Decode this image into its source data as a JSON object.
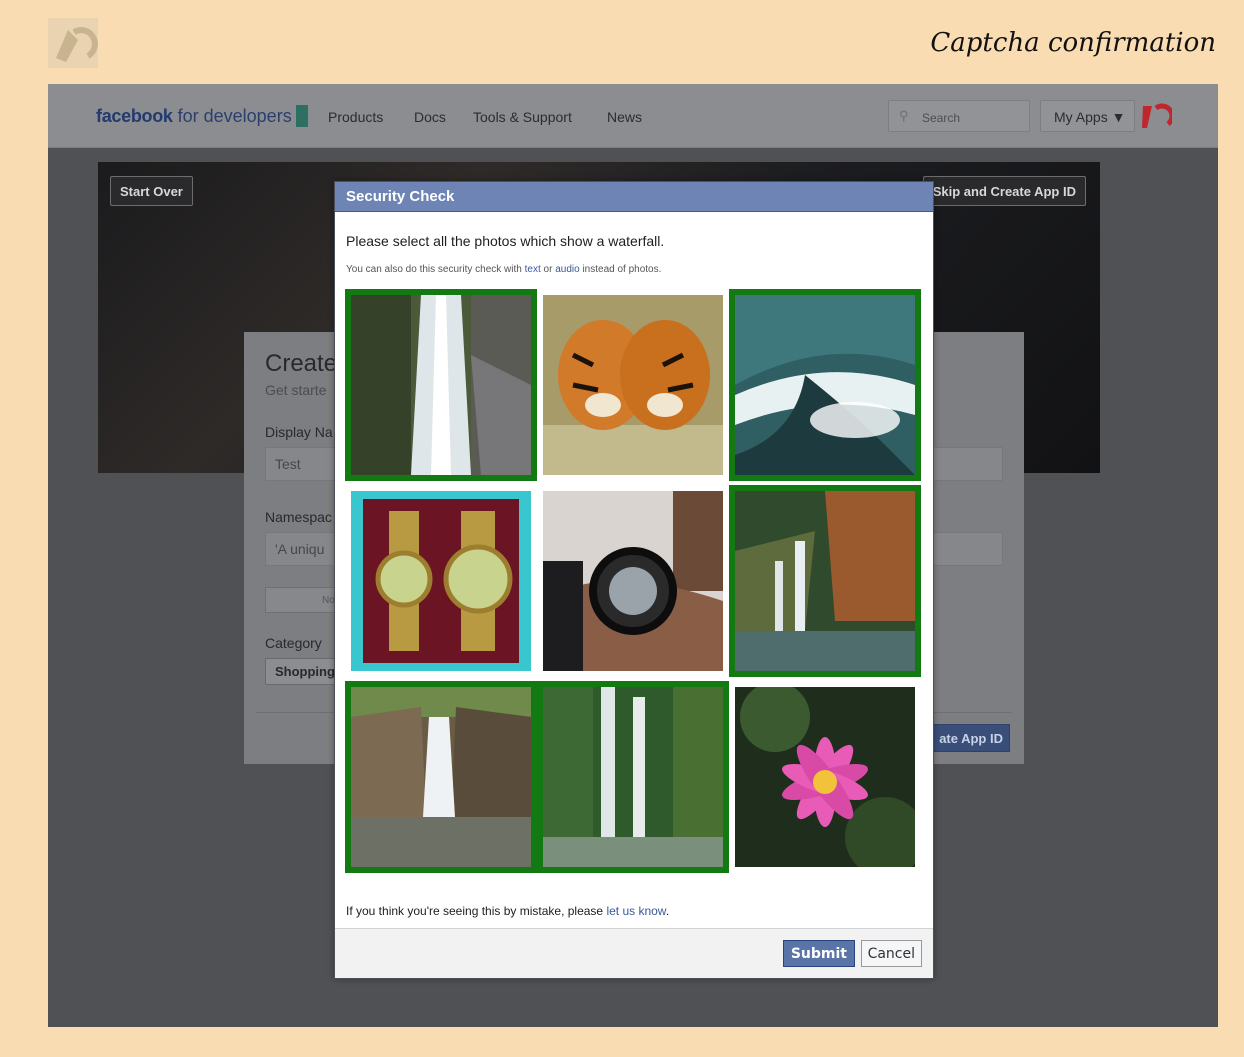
{
  "page": {
    "title": "Captcha confirmation"
  },
  "nav": {
    "brand_bold": "facebook",
    "brand_rest": " for developers",
    "links": [
      "Products",
      "Docs",
      "Tools & Support",
      "News"
    ],
    "search_placeholder": "Search",
    "my_apps": "My Apps ▼"
  },
  "hero": {
    "start_over": "Start Over",
    "skip": "Skip and Create App ID"
  },
  "create_form": {
    "title": "Create",
    "subtitle": "Get starte",
    "display_name_label": "Display Na",
    "display_name_value": "Test",
    "namespace_label": "Namespac",
    "namespace_placeholder": "'A uniqu",
    "toggle_label": "No",
    "category_label": "Category",
    "category_value": "Shopping",
    "create_button": "ate App ID"
  },
  "dialog": {
    "title": "Security Check",
    "question": "Please select all the photos which show a waterfall.",
    "alt_prefix": "You can also do this security check with ",
    "alt_text_link": "text",
    "alt_or": " or ",
    "alt_audio_link": "audio",
    "alt_suffix": " instead of photos.",
    "photos": [
      {
        "subject": "waterfall-photo",
        "selected": true
      },
      {
        "subject": "tigers-photo",
        "selected": false
      },
      {
        "subject": "waterfall-photo",
        "selected": true
      },
      {
        "subject": "watches-photo",
        "selected": false
      },
      {
        "subject": "wristwatch-photo",
        "selected": false
      },
      {
        "subject": "waterfall-photo",
        "selected": true
      },
      {
        "subject": "waterfall-photo",
        "selected": true
      },
      {
        "subject": "waterfall-photo",
        "selected": true
      },
      {
        "subject": "lotus-flower-photo",
        "selected": false
      }
    ],
    "mistake_text": "If you think you're seeing this by mistake, please ",
    "mistake_link": "let us know",
    "mistake_end": ".",
    "submit": "Submit",
    "cancel": "Cancel"
  },
  "colors": {
    "selected_border": "#137a13",
    "dialog_header": "#6d84b4",
    "submit": "#5b74a8"
  }
}
